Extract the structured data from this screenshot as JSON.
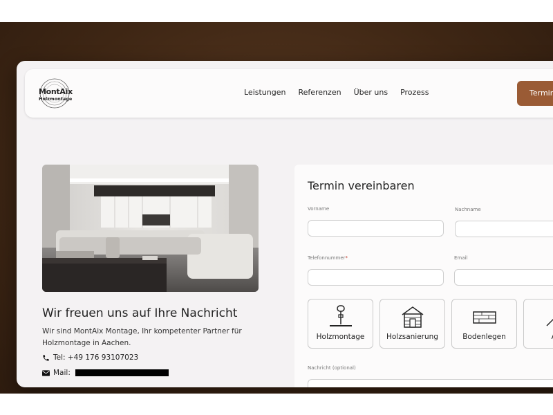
{
  "brand": {
    "logo_line1": "MontAix",
    "logo_line2": "Holzmontage"
  },
  "nav": {
    "links": [
      "Leistungen",
      "Referenzen",
      "Über uns",
      "Prozess"
    ],
    "cta_label": "Termin"
  },
  "intro": {
    "title": "Wir freuen uns auf Ihre Nachricht",
    "description": "Wir sind MontAix Montage, Ihr kompetenter Partner für Holzmontage in Aachen.",
    "phone": "Tel: +49 176 93107023",
    "mail_label": "Mail:"
  },
  "form": {
    "title": "Termin vereinbaren",
    "fields": {
      "vorname_label": "Vorname",
      "nachname_label": "Nachname",
      "telefon_label": "Telefonnummer",
      "telefon_required": "*",
      "email_label": "Email",
      "nachricht_label": "Nachricht (optional)"
    },
    "services": [
      "Holzmontage",
      "Holzsanierung",
      "Bodenlegen",
      "Ab"
    ]
  },
  "colors": {
    "accent": "#9a5b35",
    "backdrop": "#3e2614"
  }
}
